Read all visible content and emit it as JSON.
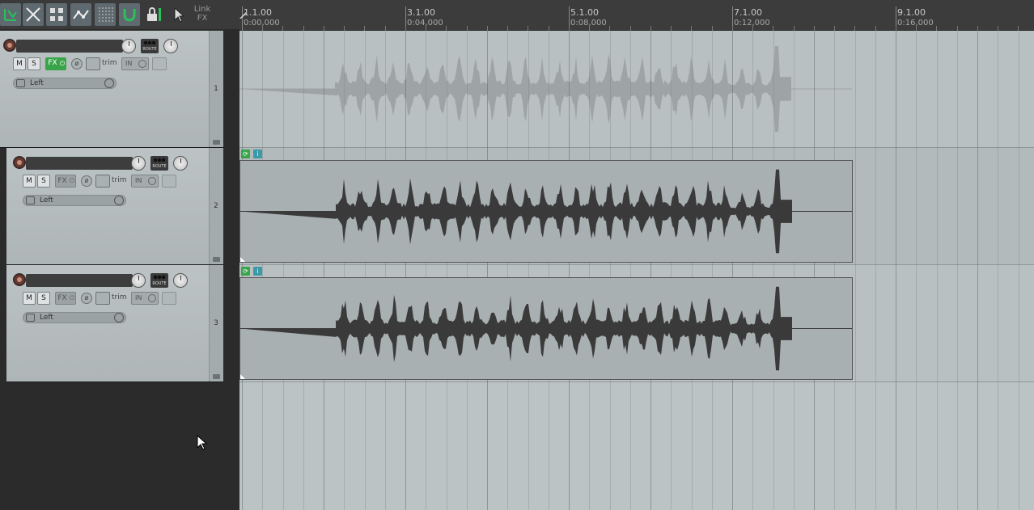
{
  "toolbar": {
    "buttons": [
      {
        "name": "ripple-edit-icon",
        "on": true
      },
      {
        "name": "auto-crossfade-icon",
        "on": true
      },
      {
        "name": "grouping-icon",
        "on": true
      },
      {
        "name": "envelope-points-icon",
        "on": true
      },
      {
        "name": "grid-icon",
        "on": true
      },
      {
        "name": "snap-magnet-icon",
        "on": true
      },
      {
        "name": "lock-icon",
        "on": false
      },
      {
        "name": "pointer-tool-icon",
        "on": false
      }
    ],
    "link_fx_line1": "Link",
    "link_fx_line2": "FX"
  },
  "ruler": {
    "bars": [
      {
        "bar": "1.1.00",
        "time": "0:00,000"
      },
      {
        "bar": "3.1.00",
        "time": "0:04,000"
      },
      {
        "bar": "5.1.00",
        "time": "0:08,000"
      },
      {
        "bar": "7.1.00",
        "time": "0:12,000"
      },
      {
        "bar": "9.1.00",
        "time": "0:16,000"
      }
    ]
  },
  "tracks": [
    {
      "number": "1",
      "mute": "M",
      "solo": "S",
      "fx": "FX",
      "fx_active": true,
      "trim": "trim",
      "input": "IN",
      "io": "Left",
      "route": "ROUTE"
    },
    {
      "number": "2",
      "mute": "M",
      "solo": "S",
      "fx": "FX",
      "fx_active": false,
      "trim": "trim",
      "input": "IN",
      "io": "Left",
      "route": "ROUTE"
    },
    {
      "number": "3",
      "mute": "M",
      "solo": "S",
      "fx": "FX",
      "fx_active": false,
      "trim": "trim",
      "input": "IN",
      "io": "Left",
      "route": "ROUTE"
    }
  ],
  "colors": {
    "accent_green": "#3aa44a",
    "item_info": "#3a9aa8",
    "waveform_active": "#3a3a3a",
    "waveform_ghost": "#9ea4a6"
  }
}
